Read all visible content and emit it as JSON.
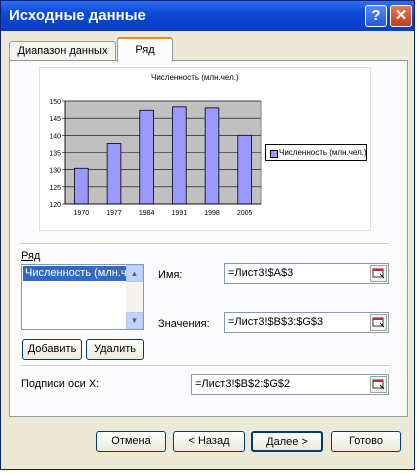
{
  "window": {
    "title": "Исходные данные",
    "help_label": "?",
    "close_label": "✕"
  },
  "tabs": [
    {
      "label": "Диапазон данных"
    },
    {
      "label": "Ряд"
    }
  ],
  "chart_data": {
    "type": "bar",
    "title": "Численность (млн.чел.)",
    "categories": [
      "1970",
      "1977",
      "1984",
      "1991",
      "1998",
      "2005"
    ],
    "series": [
      {
        "name": "Численность (млн.чел.)",
        "values": [
          130.4,
          137.6,
          147.3,
          148.3,
          148.0,
          140.0
        ]
      }
    ],
    "ylim": [
      120,
      150
    ],
    "yticks": [
      "120",
      "125",
      "130",
      "135",
      "140",
      "145",
      "150"
    ],
    "grid": true,
    "legend": "right",
    "colors": {
      "bar": "#9999ff",
      "plot_bg": "#c0c0c0"
    }
  },
  "series_panel": {
    "label": "Ряд",
    "list": [
      "Численность (млн.ч"
    ],
    "add_button": "Добавить",
    "remove_button": "Удалить"
  },
  "fields": {
    "name_label": "Имя:",
    "name_value": "=Лист3!$A$3",
    "values_label": "Значения:",
    "values_value": "=Лист3!$B$3:$G$3",
    "xlabels_label": "Подписи оси X:",
    "xlabels_value": "=Лист3!$B$2:$G$2"
  },
  "buttons": {
    "cancel": "Отмена",
    "back": "< Назад",
    "next": "Далее >",
    "finish": "Готово"
  }
}
